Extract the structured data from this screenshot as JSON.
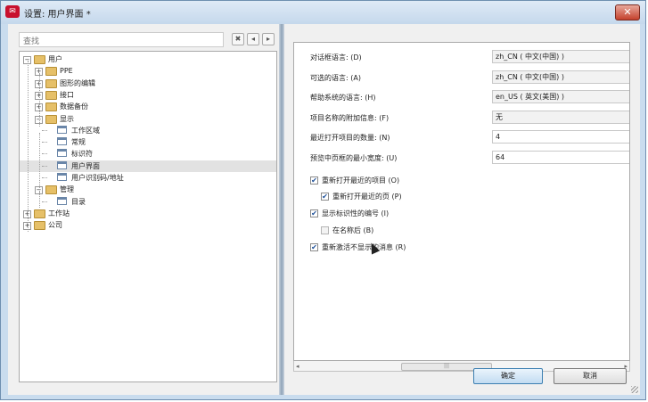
{
  "window": {
    "title": "设置: 用户界面 *",
    "app_icon_text": "✉",
    "close_label": "✕"
  },
  "left": {
    "search_placeholder": "查找",
    "toolbar": {
      "clear_icon": "✖",
      "expand_icon": "◂",
      "collapse_icon": "▸"
    },
    "tree": [
      {
        "label": "用户",
        "level": 0,
        "type": "folder",
        "expander": "−"
      },
      {
        "label": "PPE",
        "level": 1,
        "type": "folder",
        "expander": "+"
      },
      {
        "label": "图形的编辑",
        "level": 1,
        "type": "folder",
        "expander": "+"
      },
      {
        "label": "接口",
        "level": 1,
        "type": "folder",
        "expander": "+"
      },
      {
        "label": "数据备份",
        "level": 1,
        "type": "folder",
        "expander": "+"
      },
      {
        "label": "显示",
        "level": 1,
        "type": "folder",
        "expander": "−"
      },
      {
        "label": "工作区域",
        "level": 2,
        "type": "page"
      },
      {
        "label": "常规",
        "level": 2,
        "type": "page"
      },
      {
        "label": "标识符",
        "level": 2,
        "type": "page"
      },
      {
        "label": "用户界面",
        "level": 2,
        "type": "page",
        "selected": true
      },
      {
        "label": "用户识别码/地址",
        "level": 2,
        "type": "page"
      },
      {
        "label": "管理",
        "level": 1,
        "type": "folder",
        "expander": "−"
      },
      {
        "label": "目录",
        "level": 2,
        "type": "page"
      },
      {
        "label": "工作站",
        "level": 0,
        "type": "folder",
        "expander": "+"
      },
      {
        "label": "公司",
        "level": 0,
        "type": "folder",
        "expander": "+"
      }
    ]
  },
  "right": {
    "properties": [
      {
        "label": "对话框语言: (D)",
        "value": "zh_CN ( 中文(中国) )",
        "kind": "combo"
      },
      {
        "label": "可选的语言: (A)",
        "value": "zh_CN ( 中文(中国) )",
        "kind": "combo"
      },
      {
        "label": "帮助系统的语言: (H)",
        "value": "en_US ( 英文(美国) )",
        "kind": "combo"
      },
      {
        "label": "项目名称的附加信息: (F)",
        "value": "无",
        "kind": "combo"
      },
      {
        "label": "最近打开项目的数量: (N)",
        "value": "4",
        "kind": "text"
      },
      {
        "label": "预览中页框的最小宽度: (U)",
        "value": "64",
        "kind": "text"
      }
    ],
    "checkboxes": [
      {
        "label": "重新打开最近的项目 (O)",
        "checked": true,
        "indent": 0
      },
      {
        "label": "重新打开最近的页 (P)",
        "checked": true,
        "indent": 1
      },
      {
        "label": "显示标识性的编号 (I)",
        "checked": true,
        "indent": 0
      },
      {
        "label": "在名称后 (B)",
        "checked": false,
        "indent": 1
      },
      {
        "label": "重新激活不显示的消息 (R)",
        "checked": true,
        "indent": 0
      }
    ],
    "scrollbar": {
      "left_arrow": "◂",
      "right_arrow": "▸",
      "thumb_grip": "|||"
    },
    "buttons": {
      "ok": "确定",
      "cancel": "取消"
    },
    "check_mark": "✔"
  }
}
